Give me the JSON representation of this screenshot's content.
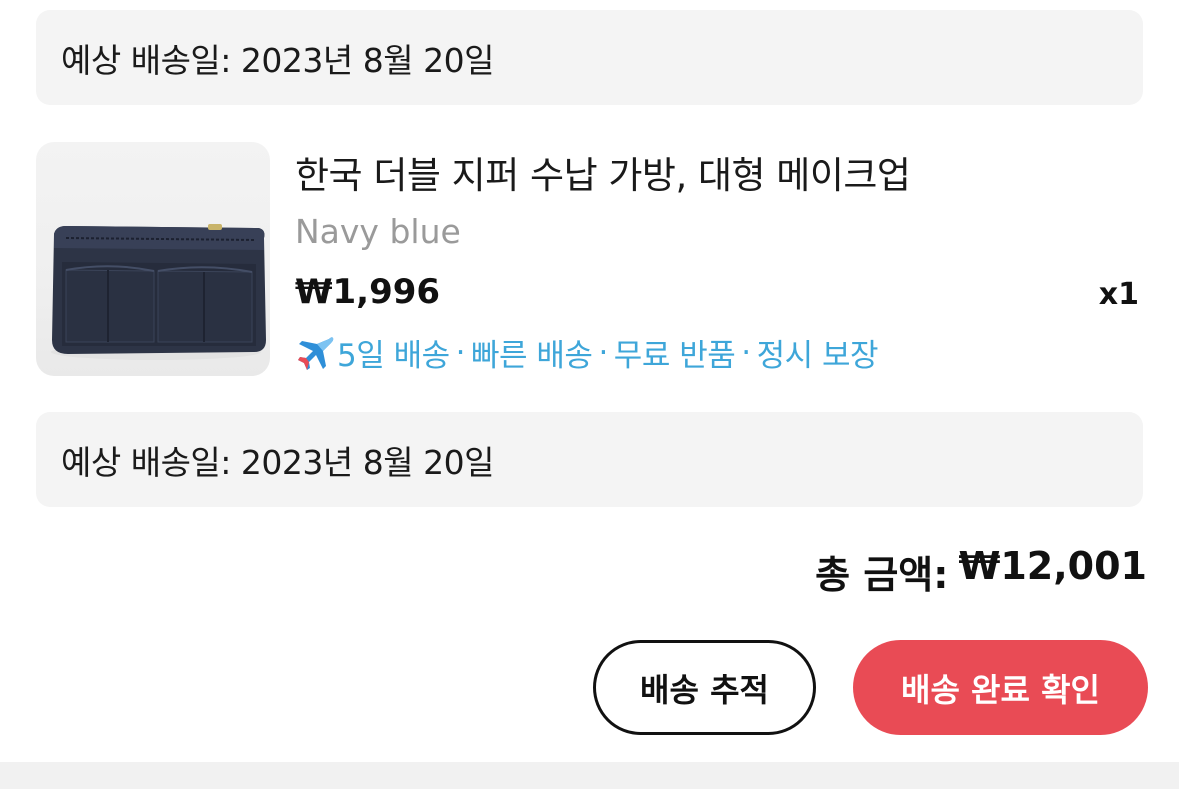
{
  "delivery_top": {
    "text": "예상 배송일: 2023년 8월 20일"
  },
  "product": {
    "title": "한국 더블 지퍼 수납 가방, 대형 메이크업",
    "variant": "Navy blue",
    "price": "₩1,996",
    "quantity": "x1",
    "image_icon": "navy-organizer-bag-image",
    "benefits": {
      "icon": "airplane-icon",
      "items": [
        "5일 배송",
        "빠른 배송",
        "무료 반품",
        "정시 보장"
      ],
      "separator": "·",
      "color": "#3ea6d9"
    }
  },
  "delivery_bottom": {
    "text": "예상 배송일: 2023년 8월 20일"
  },
  "total": {
    "label": "총 금액:",
    "amount": "₩12,001"
  },
  "actions": {
    "track_label": "배송 추적",
    "confirm_label": "배송 완료 확인",
    "confirm_color": "#e94b55"
  }
}
